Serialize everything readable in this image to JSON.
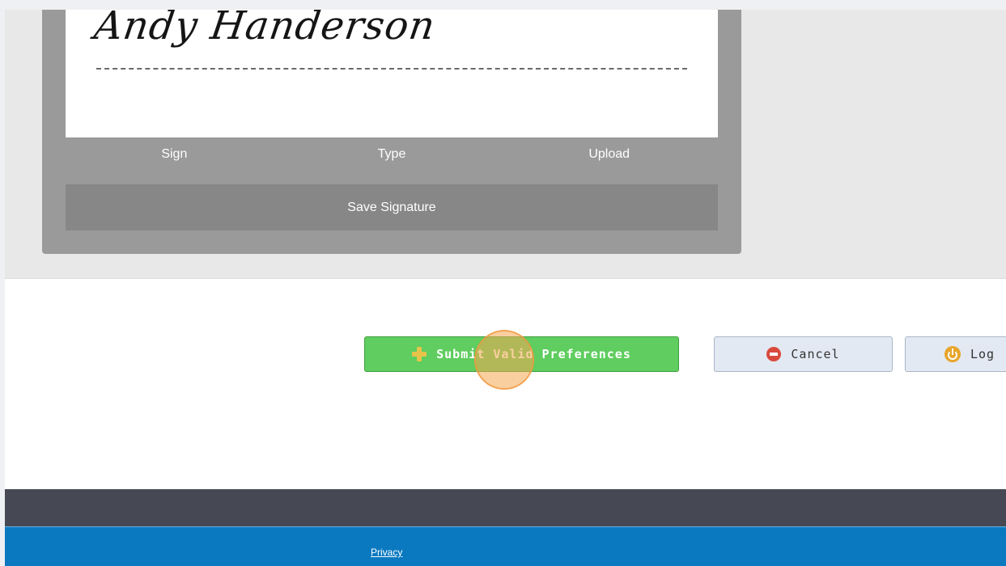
{
  "signature": {
    "name_text": "Andy Handerson",
    "tabs": [
      {
        "label": "Sign"
      },
      {
        "label": "Type"
      },
      {
        "label": "Upload"
      }
    ],
    "save_label": "Save Signature"
  },
  "actions": {
    "submit_label": "Submit Valid Preferences",
    "cancel_label": "Cancel",
    "logout_label": "Log"
  },
  "footer": {
    "privacy_label": "Privacy"
  },
  "colors": {
    "submit_bg": "#5fcd5f",
    "footer_dark": "#464854",
    "footer_blue": "#0a79c0",
    "click_highlight": "#f5a850"
  },
  "icons": {
    "submit": "plus-icon",
    "cancel": "no-entry-icon",
    "logout": "power-icon"
  }
}
